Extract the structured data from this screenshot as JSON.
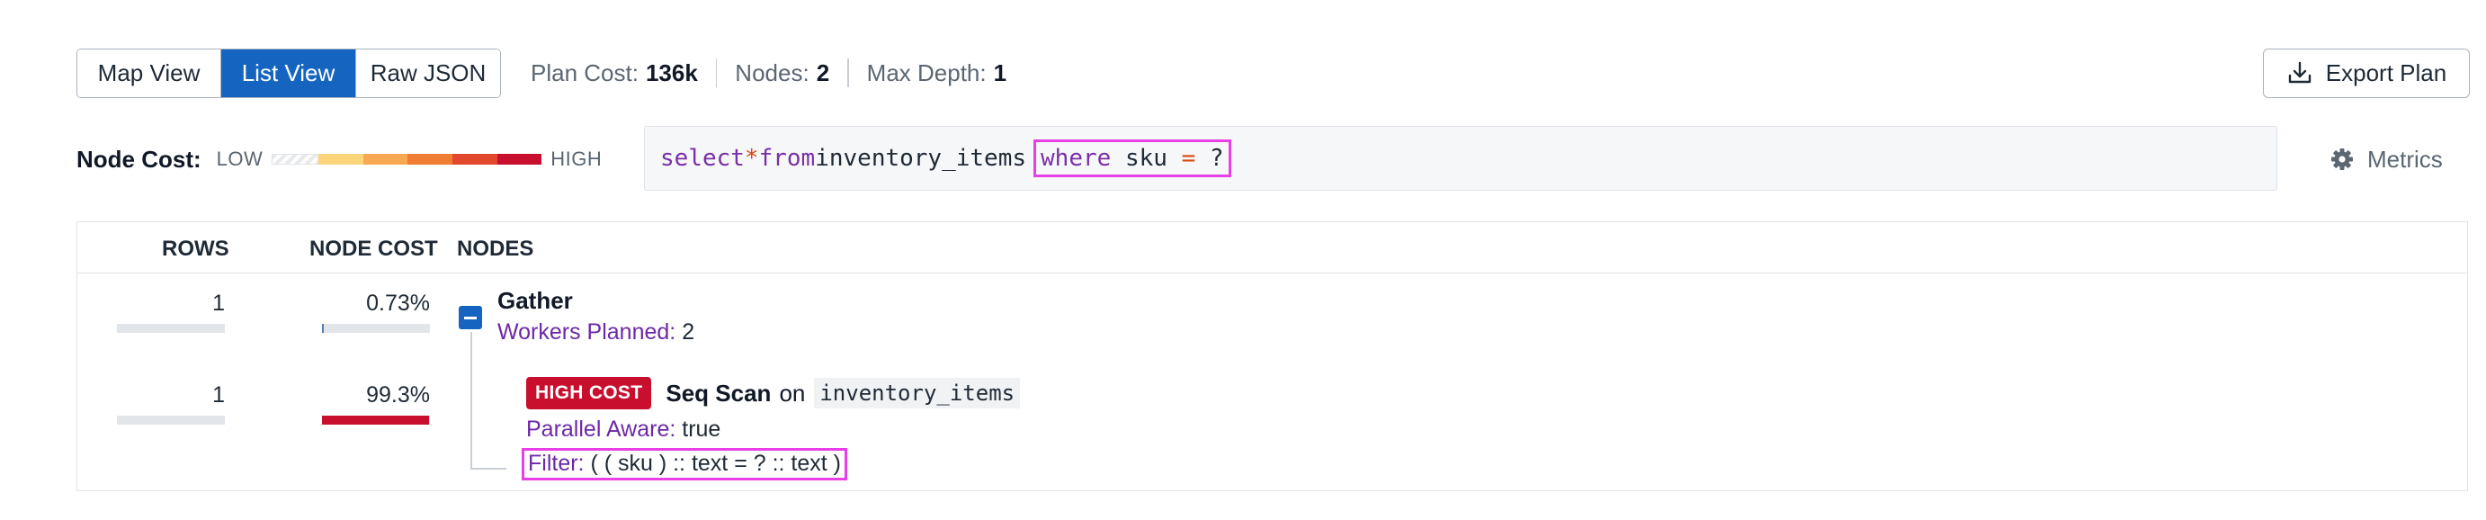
{
  "toolbar": {
    "views": [
      "Map View",
      "List View",
      "Raw JSON"
    ],
    "active_view": "List View",
    "stats": [
      {
        "label": "Plan Cost:",
        "value": "136k"
      },
      {
        "label": "Nodes:",
        "value": "2"
      },
      {
        "label": "Max Depth:",
        "value": "1"
      }
    ],
    "export_label": "Export Plan"
  },
  "legend": {
    "title": "Node Cost:",
    "low": "LOW",
    "high": "HIGH",
    "scale_colors": [
      "#f0f1f3",
      "#fcd57a",
      "#f8a752",
      "#ef7d33",
      "#e2482d",
      "#c8102e"
    ]
  },
  "query": {
    "select": "select",
    "star": "*",
    "from": "from",
    "table": "inventory_items",
    "where": "where",
    "column": "sku",
    "eq": "=",
    "param": "?"
  },
  "metrics_label": "Metrics",
  "table": {
    "headers": {
      "rows": "ROWS",
      "cost": "NODE COST",
      "nodes": "NODES"
    },
    "rows": [
      {
        "rows": "1",
        "rows_fraction": 0.0,
        "cost": "0.73%",
        "cost_fraction": 0.0073
      },
      {
        "rows": "1",
        "rows_fraction": 0.0,
        "cost": "99.3%",
        "cost_fraction": 0.993
      }
    ]
  },
  "nodes": {
    "gather": {
      "title": "Gather",
      "prop_key": "Workers Planned:",
      "prop_val": "2"
    },
    "seq_scan": {
      "badge": "HIGH COST",
      "title": "Seq Scan",
      "on": "on",
      "relation": "inventory_items",
      "prop1_key": "Parallel Aware:",
      "prop1_val": "true",
      "prop2_key": "Filter:",
      "prop2_val": "( ( sku ) :: text = ? :: text )"
    }
  },
  "colors": {
    "accent": "#1565c0",
    "high_cost": "#c8102e",
    "property_key": "#6d28a8",
    "highlight": "#e83fe6"
  }
}
